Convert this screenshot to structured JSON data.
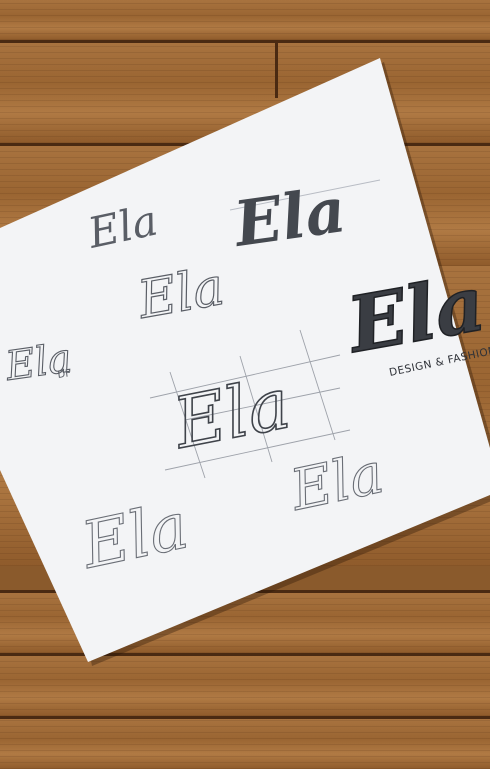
{
  "scene": {
    "description_colors": {
      "wood_light": "#b07a44",
      "wood_dark": "#8f5b2b",
      "seam": "#4a2a12",
      "paper": "#f3f4f6",
      "pencil": "#5a5e66",
      "pencil_dark": "#2f3238"
    },
    "sketches": [
      {
        "id": "sketch-1",
        "text": "Ela"
      },
      {
        "id": "sketch-2",
        "text": "Ela"
      },
      {
        "id": "sketch-3",
        "text": "Ela"
      },
      {
        "id": "sketch-4",
        "text": "Ela"
      },
      {
        "id": "sketch-4-sub",
        "text": "DF"
      },
      {
        "id": "sketch-5",
        "text": "Ela"
      },
      {
        "id": "sketch-6",
        "text": "Ela"
      },
      {
        "id": "sketch-7",
        "text": "Ela"
      },
      {
        "id": "sketch-final",
        "text": "Ela"
      },
      {
        "id": "sketch-final-tagline",
        "text": "DESIGN & FASHION"
      }
    ]
  }
}
